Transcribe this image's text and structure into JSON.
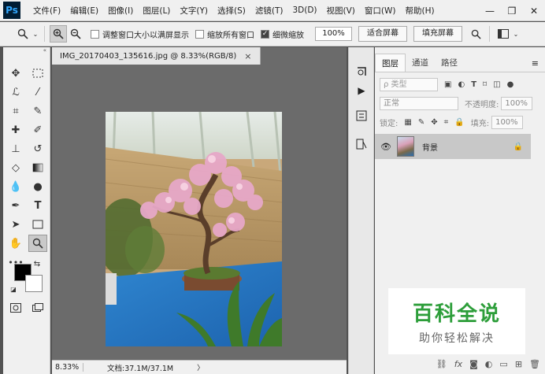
{
  "app": {
    "logo": "Ps",
    "menu": [
      "文件(F)",
      "编辑(E)",
      "图像(I)",
      "图层(L)",
      "文字(Y)",
      "选择(S)",
      "滤镜(T)",
      "3D(D)",
      "视图(V)",
      "窗口(W)",
      "帮助(H)"
    ],
    "window_controls": [
      "—",
      "❐",
      "✕"
    ]
  },
  "options_bar": {
    "checkboxes": [
      {
        "label": "调整窗口大小以满屏显示",
        "checked": false
      },
      {
        "label": "缩放所有窗口",
        "checked": false
      },
      {
        "label": "细微缩放",
        "checked": true
      }
    ],
    "zoom_value": "100%",
    "fit_screen_label": "适合屏幕",
    "fill_screen_label": "填充屏幕"
  },
  "document": {
    "tab_title": "IMG_20170403_135616.jpg @ 8.33%(RGB/8)",
    "tab_close": "×",
    "status_zoom": "8.33%",
    "status_doc": "文档:37.1M/37.1M",
    "status_arrow": "〉"
  },
  "layers_panel": {
    "tabs": [
      "图层",
      "通道",
      "路径"
    ],
    "active_tab": 0,
    "filter_placeholder": "ρ 类型",
    "blend_mode": "正常",
    "opacity_label": "不透明度:",
    "opacity_value": "100%",
    "lock_label": "锁定:",
    "fill_label": "填充:",
    "fill_value": "100%",
    "layers": [
      {
        "name": "背景",
        "visible": true,
        "locked": true
      }
    ],
    "footer_icons": [
      "link-icon",
      "fx-icon",
      "mask-icon",
      "adjustment-icon",
      "group-icon",
      "new-layer-icon",
      "trash-icon"
    ]
  },
  "watermark": {
    "title": "百科全说",
    "subtitle": "助你轻松解决"
  },
  "colors": {
    "foreground": "#000000",
    "background": "#ffffff",
    "watermark_green": "#2d9e3a"
  }
}
